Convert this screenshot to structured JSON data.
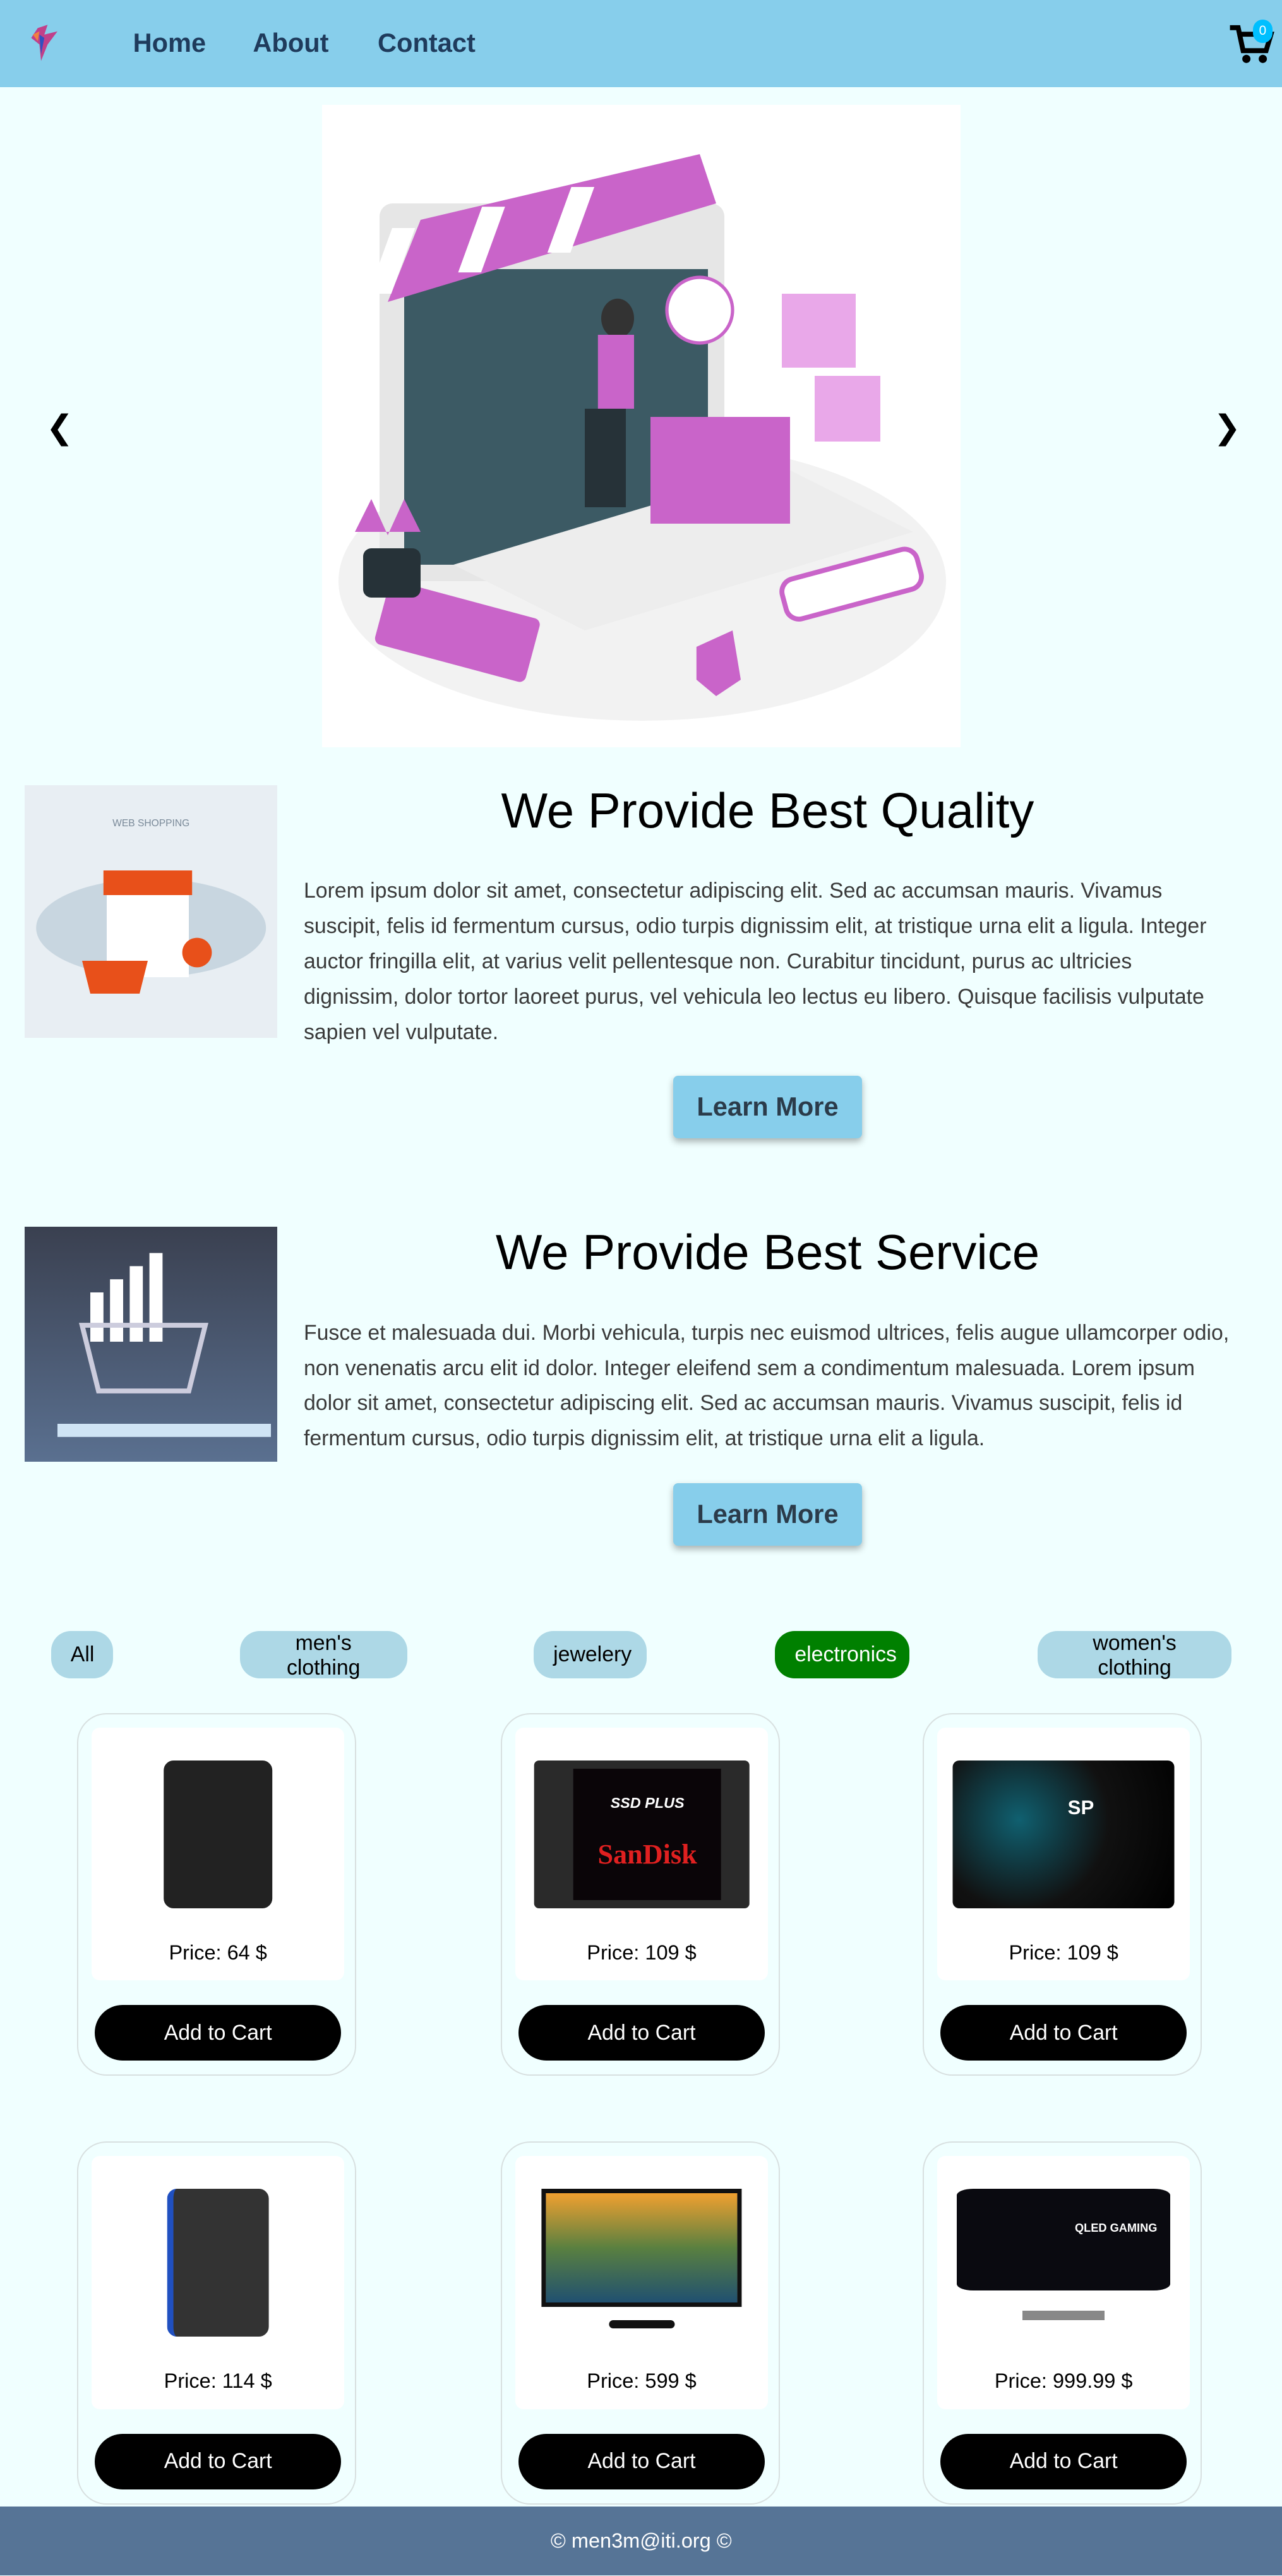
{
  "nav": {
    "links": [
      "Home",
      "About",
      "Contact"
    ],
    "cart_count": "0"
  },
  "sections": [
    {
      "title": "We Provide Best Quality",
      "image_label": "WEB SHOPPING",
      "text": "Lorem ipsum dolor sit amet, consectetur adipiscing elit. Sed ac accumsan mauris. Vivamus suscipit, felis id fermentum cursus, odio turpis dignissim elit, at tristique urna elit a ligula. Integer auctor fringilla elit, at varius velit pellentesque non. Curabitur tincidunt, purus ac ultricies dignissim, dolor tortor laoreet purus, vel vehicula leo lectus eu libero. Quisque facilisis vulputate sapien vel vulputate.",
      "button": "Learn More"
    },
    {
      "title": "We Provide Best Service",
      "text": "Fusce et malesuada dui. Morbi vehicula, turpis nec euismod ultrices, felis augue ullamcorper odio, non venenatis arcu elit id dolor. Integer eleifend sem a condimentum malesuada. Lorem ipsum dolor sit amet, consectetur adipiscing elit. Sed ac accumsan mauris. Vivamus suscipit, felis id fermentum cursus, odio turpis dignissim elit, at tristique urna elit a ligula.",
      "button": "Learn More"
    }
  ],
  "filters": [
    "All",
    "men's clothing",
    "jewelery",
    "electronics",
    "women's clothing"
  ],
  "active_filter": "electronics",
  "products": [
    {
      "price": "Price: 64 $",
      "kind": "hdd"
    },
    {
      "price": "Price: 109 $",
      "kind": "sandisk"
    },
    {
      "price": "Price: 109 $",
      "kind": "sp"
    },
    {
      "price": "Price: 114 $",
      "kind": "wd"
    },
    {
      "price": "Price: 599 $",
      "kind": "monitor"
    },
    {
      "price": "Price: 999.99 $",
      "kind": "curved"
    }
  ],
  "add_to_cart": "Add to Cart",
  "footer": "© men3m@iti.org ©",
  "colors": {
    "nav": "#87ceeb",
    "active": "#008000",
    "footer": "#567496",
    "badge": "#00bfff"
  }
}
